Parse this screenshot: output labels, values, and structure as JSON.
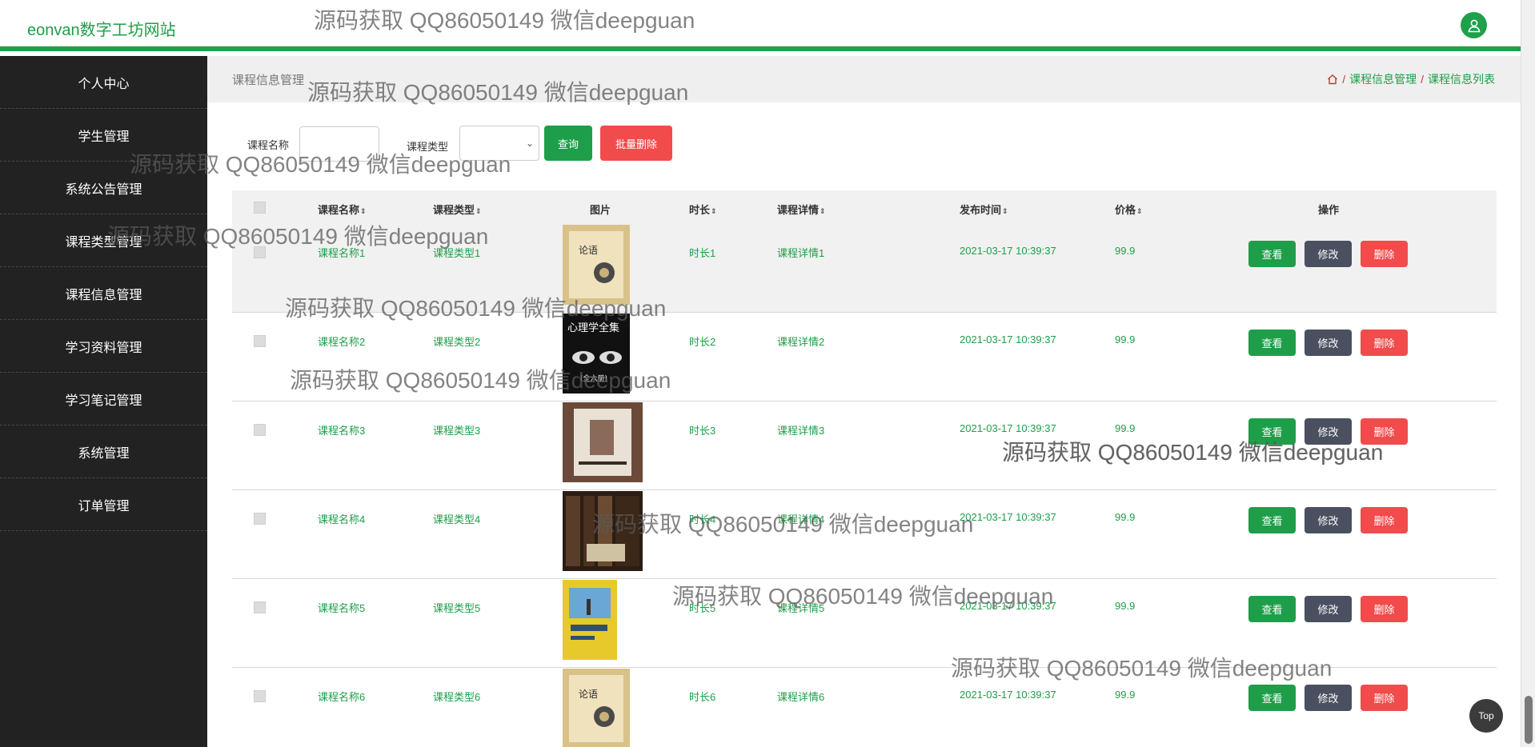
{
  "app": {
    "brand": "eonvan数字工坊网站"
  },
  "sidebar": {
    "items": [
      {
        "label": "个人中心"
      },
      {
        "label": "学生管理"
      },
      {
        "label": "系统公告管理"
      },
      {
        "label": "课程类型管理"
      },
      {
        "label": "课程信息管理"
      },
      {
        "label": "学习资料管理"
      },
      {
        "label": "学习笔记管理"
      },
      {
        "label": "系统管理"
      },
      {
        "label": "订单管理"
      }
    ]
  },
  "header": {
    "title": "课程信息管理",
    "breadcrumb": [
      "课程信息管理",
      "课程信息列表"
    ]
  },
  "filter": {
    "name_label": "课程名称",
    "name_value": "",
    "type_label": "课程类型",
    "type_value": "",
    "search_label": "查询",
    "batch_delete_label": "批量删除"
  },
  "table": {
    "columns": [
      "课程名称",
      "课程类型",
      "图片",
      "时长",
      "课程详情",
      "发布时间",
      "价格",
      "操作"
    ],
    "action_labels": {
      "view": "查看",
      "edit": "修改",
      "delete": "删除"
    },
    "rows": [
      {
        "name": "课程名称1",
        "type": "课程类型1",
        "duration": "时长1",
        "detail": "课程详情1",
        "time": "2021-03-17 10:39:37",
        "price": "99.9",
        "image": "book-cover-lunyu"
      },
      {
        "name": "课程名称2",
        "type": "课程类型2",
        "duration": "时长2",
        "detail": "课程详情2",
        "time": "2021-03-17 10:39:37",
        "price": "99.9",
        "image": "book-cover-psychology"
      },
      {
        "name": "课程名称3",
        "type": "课程类型3",
        "duration": "时长3",
        "detail": "课程详情3",
        "time": "2021-03-17 10:39:37",
        "price": "99.9",
        "image": "book-cover-brown"
      },
      {
        "name": "课程名称4",
        "type": "课程类型4",
        "duration": "时长4",
        "detail": "课程详情4",
        "time": "2021-03-17 10:39:37",
        "price": "99.9",
        "image": "library-photo"
      },
      {
        "name": "课程名称5",
        "type": "课程类型5",
        "duration": "时长5",
        "detail": "课程详情5",
        "time": "2021-03-17 10:39:37",
        "price": "99.9",
        "image": "book-cover-yellow"
      },
      {
        "name": "课程名称6",
        "type": "课程类型6",
        "duration": "时长6",
        "detail": "课程详情6",
        "time": "2021-03-17 10:39:37",
        "price": "99.9",
        "image": "book-cover-lunyu"
      }
    ]
  },
  "top_button": "Top",
  "watermark": "源码获取 QQ86050149 微信deepguan",
  "colors": {
    "accent": "#1e9e49",
    "danger": "#f24b4b",
    "sidebar": "#222222",
    "edit": "#4a5060"
  }
}
